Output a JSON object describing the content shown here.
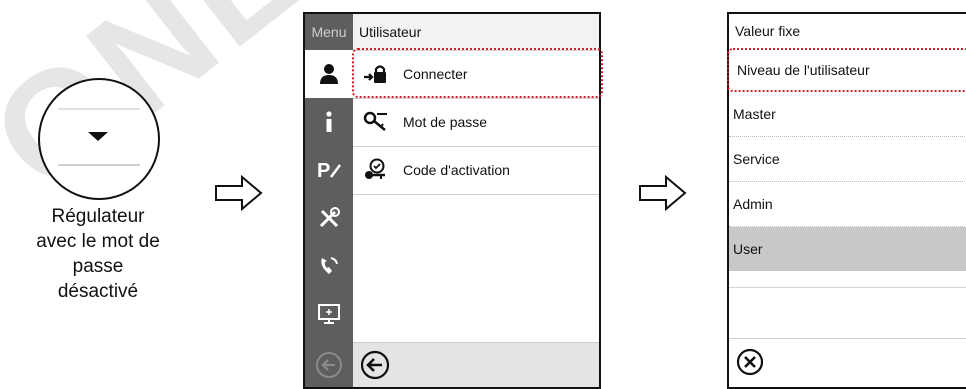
{
  "watermark": {
    "text": "ONLINE"
  },
  "controller": {
    "caption_lines": [
      "Régulateur",
      "avec le mot de",
      "passe",
      "désactivé"
    ]
  },
  "screen_menu": {
    "sidebar_label": "Menu",
    "header": "Utilisateur",
    "items": [
      {
        "label": "Connecter",
        "icon": "login-lock-icon"
      },
      {
        "label": "Mot de passe",
        "icon": "key-icon"
      },
      {
        "label": "Code d'activation",
        "icon": "activation-key-icon"
      }
    ],
    "sidebar_icons": [
      "user-icon",
      "info-icon",
      "program-icon",
      "tools-icon",
      "service-phone-icon",
      "display-icon"
    ]
  },
  "screen_level": {
    "header": "Valeur fixe",
    "field_label": "Niveau de l'utilisateur",
    "options": [
      "Master",
      "Service",
      "Admin",
      "User"
    ],
    "selected_option": "User"
  },
  "colors": {
    "highlight": "#d2202a",
    "sidebar": "#5e5e5e",
    "selected_row": "#c8c8c8"
  }
}
